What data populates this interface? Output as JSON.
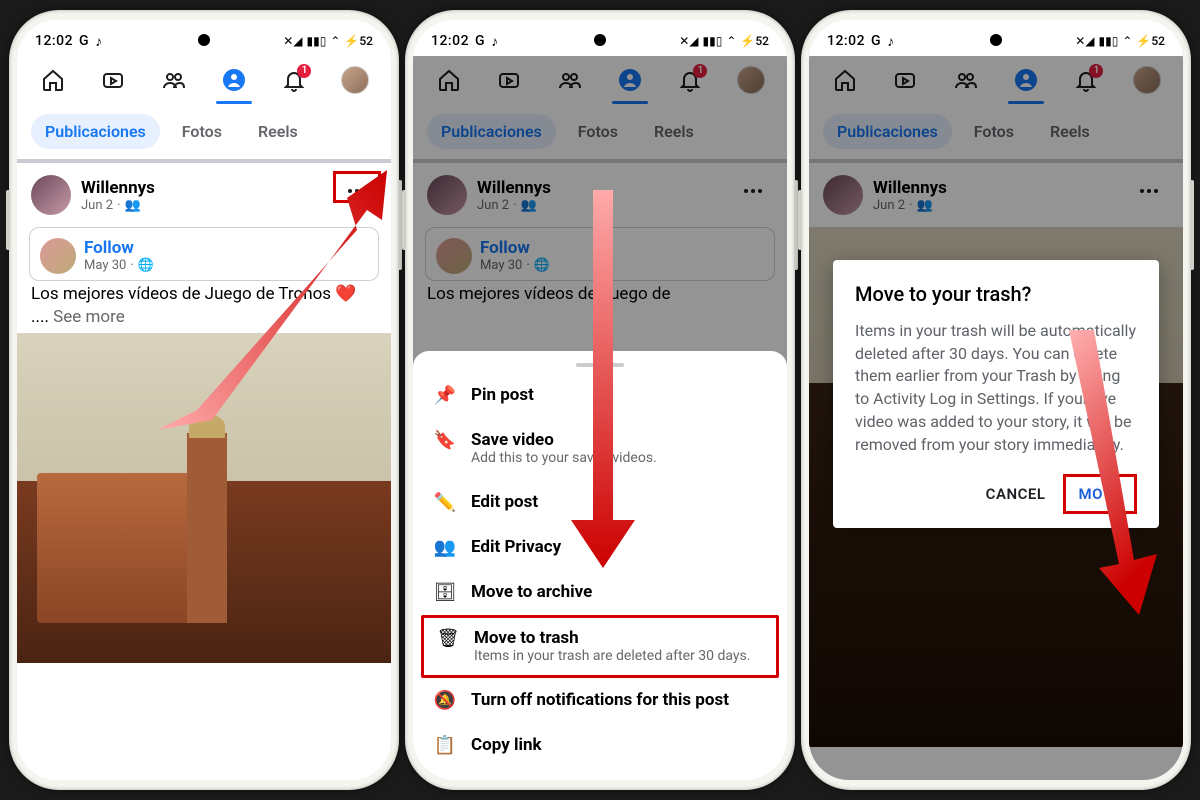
{
  "status": {
    "time": "12:02",
    "g": "G",
    "music": "♪",
    "battery": "52"
  },
  "nav": {
    "badge": "1"
  },
  "tabs": {
    "posts": "Publicaciones",
    "photos": "Fotos",
    "reels": "Reels"
  },
  "post": {
    "author": "Willennys",
    "date": "Jun 2",
    "follow": "Follow",
    "inner_date": "May 30",
    "text_full": "Los mejores vídeos de Juego de Tronos ❤️",
    "text_trunc": "Los mejores vídeos de Juego de",
    "ellipsis": "....",
    "seemore": "See more"
  },
  "menu": {
    "pin": "Pin post",
    "save": "Save video",
    "save_sub": "Add this to your saved videos.",
    "edit": "Edit post",
    "privacy": "Edit Privacy",
    "archive": "Move to archive",
    "trash": "Move to trash",
    "trash_sub": "Items in your trash are deleted after 30 days.",
    "notif": "Turn off notifications for this post",
    "copy": "Copy link"
  },
  "dialog": {
    "title": "Move to your trash?",
    "body": "Items in your trash will be automatically deleted after 30 days. You can delete them earlier from your Trash by going to Activity Log in Settings. If your live video was added to your story, it will be removed from your story immediately.",
    "cancel": "CANCEL",
    "move": "MOVE"
  }
}
